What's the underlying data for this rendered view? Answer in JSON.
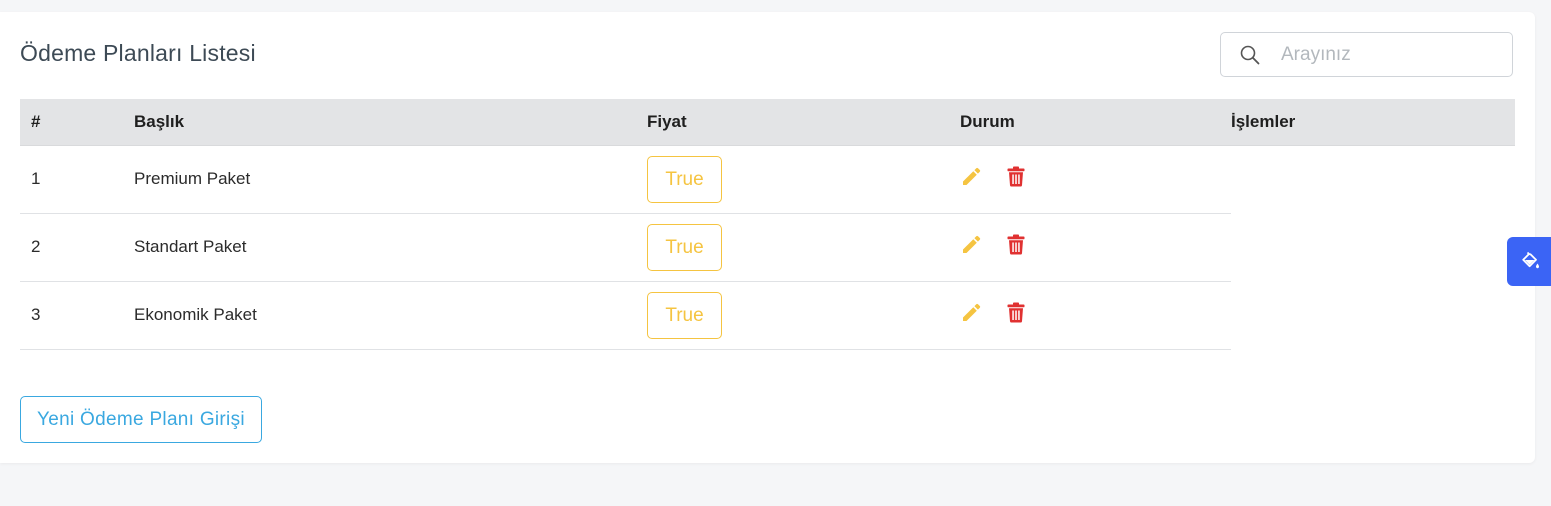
{
  "page": {
    "title": "Ödeme Planları Listesi"
  },
  "search": {
    "placeholder": "Arayınız",
    "icon": "search-icon"
  },
  "table": {
    "columns": [
      "#",
      "Başlık",
      "Fiyat",
      "Durum",
      "İşlemler"
    ],
    "rows": [
      {
        "num": "1",
        "title": "Premium Paket",
        "price": "True"
      },
      {
        "num": "2",
        "title": "Standart Paket",
        "price": "True"
      },
      {
        "num": "3",
        "title": "Ekonomik Paket",
        "price": "True"
      }
    ],
    "actions": {
      "edit_icon": "pencil-icon",
      "delete_icon": "trash-icon"
    }
  },
  "buttons": {
    "new_plan": "Yeni Ödeme Planı Girişi"
  },
  "side_tab": {
    "icon": "paint-bucket-icon"
  },
  "colors": {
    "badge": "#f5c441",
    "edit": "#f5c441",
    "delete": "#e03131",
    "primary_button": "#3aa8e0",
    "side_tab": "#3b64f5",
    "header_bg": "#e3e4e6"
  }
}
